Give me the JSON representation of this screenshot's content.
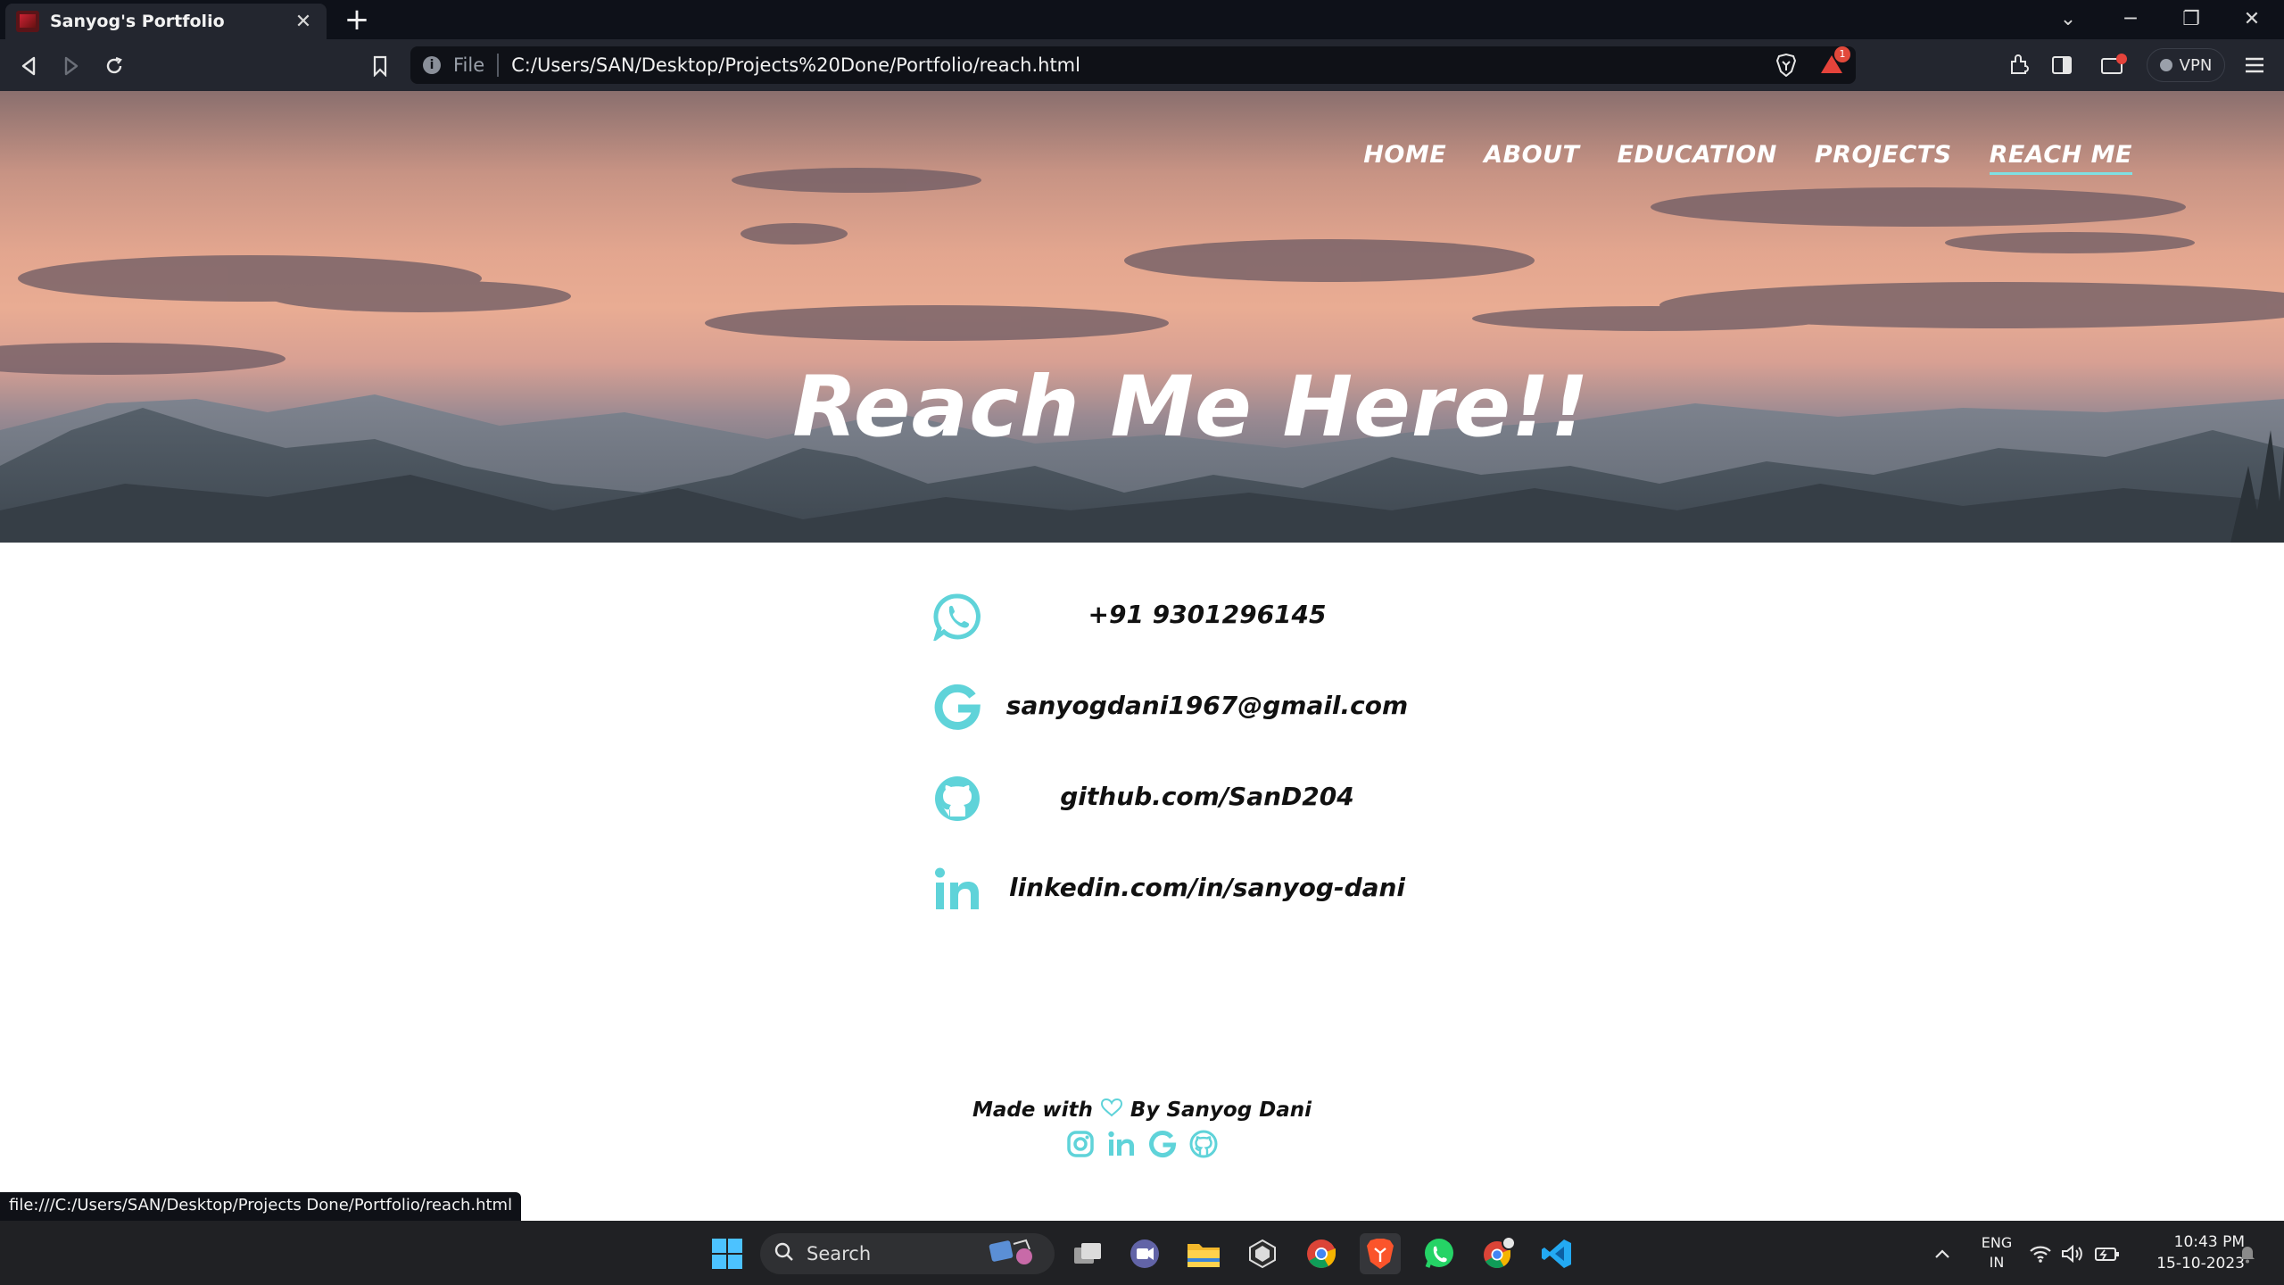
{
  "browser": {
    "tab_title": "Sanyog's Portfolio",
    "address_scheme": "File",
    "address_url": "C:/Users/SAN/Desktop/Projects%20Done/Portfolio/reach.html",
    "shields_badge": "1",
    "vpn_label": "VPN",
    "status_url": "file:///C:/Users/SAN/Desktop/Projects Done/Portfolio/reach.html"
  },
  "site": {
    "nav": [
      {
        "label": "HOME"
      },
      {
        "label": "ABOUT"
      },
      {
        "label": "EDUCATION"
      },
      {
        "label": "PROJECTS"
      },
      {
        "label": "REACH ME",
        "active": true
      }
    ],
    "hero_title": "Reach Me Here!!",
    "contacts": [
      {
        "icon": "whatsapp-icon",
        "text": "+91 9301296145"
      },
      {
        "icon": "google-icon",
        "text": "sanyogdani1967@gmail.com"
      },
      {
        "icon": "github-icon",
        "text": "github.com/SanD204"
      },
      {
        "icon": "linkedin-icon",
        "text": "linkedin.com/in/sanyog-dani"
      }
    ],
    "footer": {
      "made_with": "Made with",
      "by": "By Sanyog Dani",
      "icons": [
        "instagram-icon",
        "linkedin-icon",
        "google-icon",
        "github-icon"
      ]
    },
    "accent_color": "#5fd3d9"
  },
  "taskbar": {
    "search_placeholder": "Search",
    "lang_line1": "ENG",
    "lang_line2": "IN",
    "time": "10:43 PM",
    "date": "15-10-2023"
  }
}
